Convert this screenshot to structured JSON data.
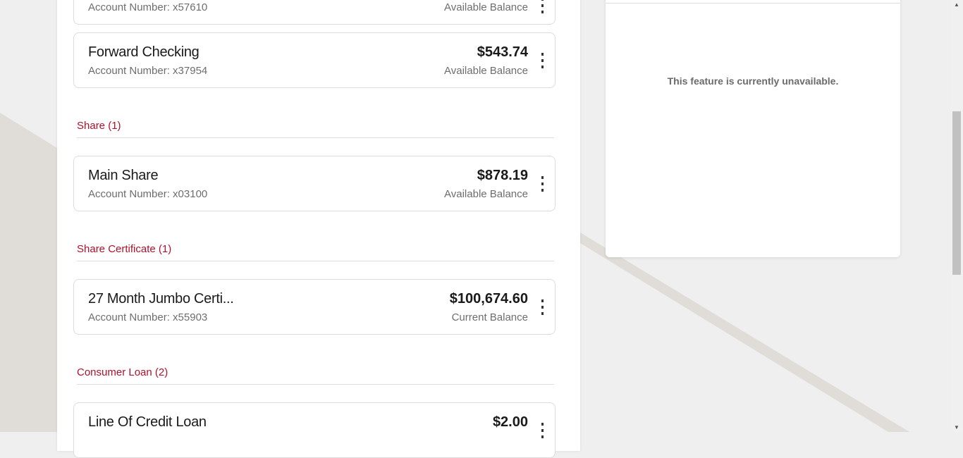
{
  "accounts_top": [
    {
      "name": "",
      "account_number": "Account Number: x57610",
      "amount": "",
      "balance_label": "Available Balance"
    },
    {
      "name": "Forward Checking",
      "account_number": "Account Number: x37954",
      "amount": "$543.74",
      "balance_label": "Available Balance"
    }
  ],
  "sections": [
    {
      "title": "Share (1)",
      "accounts": [
        {
          "name": "Main Share",
          "account_number": "Account Number: x03100",
          "amount": "$878.19",
          "balance_label": "Available Balance"
        }
      ]
    },
    {
      "title": "Share Certificate (1)",
      "accounts": [
        {
          "name": "27 Month Jumbo Certi...",
          "account_number": "Account Number: x55903",
          "amount": "$100,674.60",
          "balance_label": "Current Balance"
        }
      ]
    },
    {
      "title": "Consumer Loan (2)",
      "accounts": [
        {
          "name": "Line Of Credit Loan",
          "amount": "$2.00"
        }
      ]
    }
  ],
  "side_panel": {
    "message": "This feature is currently unavailable."
  },
  "colors": {
    "accent": "#b0102b",
    "background": "#efefef",
    "band": "#e0ddd8"
  }
}
